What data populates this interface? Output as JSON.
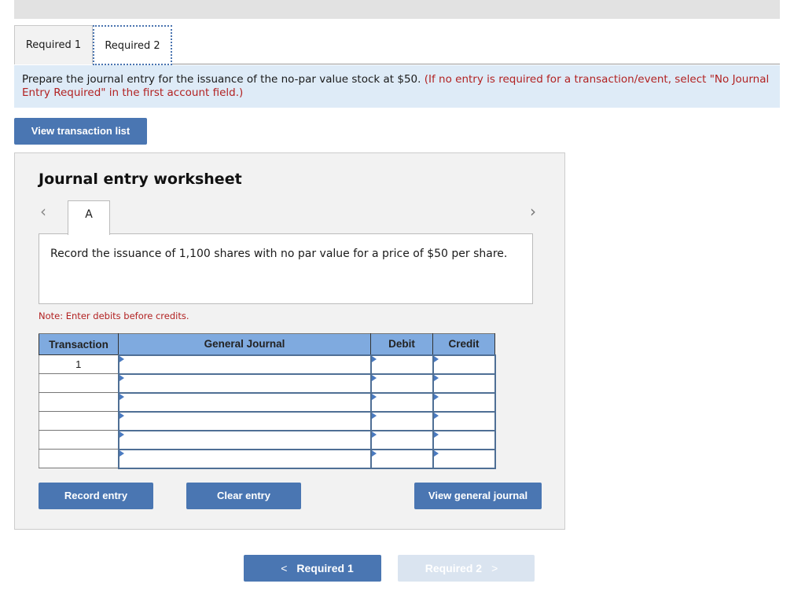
{
  "tabs": [
    {
      "label": "Required 1",
      "active": false
    },
    {
      "label": "Required 2",
      "active": true
    }
  ],
  "instructions": {
    "main": "Prepare the journal entry for the issuance of the no-par value stock at $50.",
    "note": "(If no entry is required for a transaction/event, select \"No Journal Entry Required\" in the first account field.)"
  },
  "buttons": {
    "view_transaction_list": "View transaction list",
    "record_entry": "Record entry",
    "clear_entry": "Clear entry",
    "view_general_journal": "View general journal",
    "prev_required": "Required 1",
    "next_required": "Required 2"
  },
  "worksheet": {
    "title": "Journal entry worksheet",
    "prev_icon": "‹",
    "next_icon": "›",
    "entry_tab": "A",
    "description": "Record the issuance of 1,100 shares with no par value for a price of $50 per share.",
    "note": "Note: Enter debits before credits."
  },
  "table": {
    "headers": {
      "transaction": "Transaction",
      "general_journal": "General Journal",
      "debit": "Debit",
      "credit": "Credit"
    },
    "rows": [
      {
        "transaction": "1",
        "account": "",
        "debit": "",
        "credit": ""
      },
      {
        "transaction": "",
        "account": "",
        "debit": "",
        "credit": ""
      },
      {
        "transaction": "",
        "account": "",
        "debit": "",
        "credit": ""
      },
      {
        "transaction": "",
        "account": "",
        "debit": "",
        "credit": ""
      },
      {
        "transaction": "",
        "account": "",
        "debit": "",
        "credit": ""
      },
      {
        "transaction": "",
        "account": "",
        "debit": "",
        "credit": ""
      }
    ]
  },
  "icons": {
    "chevron_left": "<",
    "chevron_right": ">"
  },
  "colors": {
    "accent": "#4a76b2",
    "header_blue": "#7faadf",
    "instruction_bg": "#deebf7",
    "error_red": "#b22222",
    "disabled_btn": "#dae4f0"
  }
}
